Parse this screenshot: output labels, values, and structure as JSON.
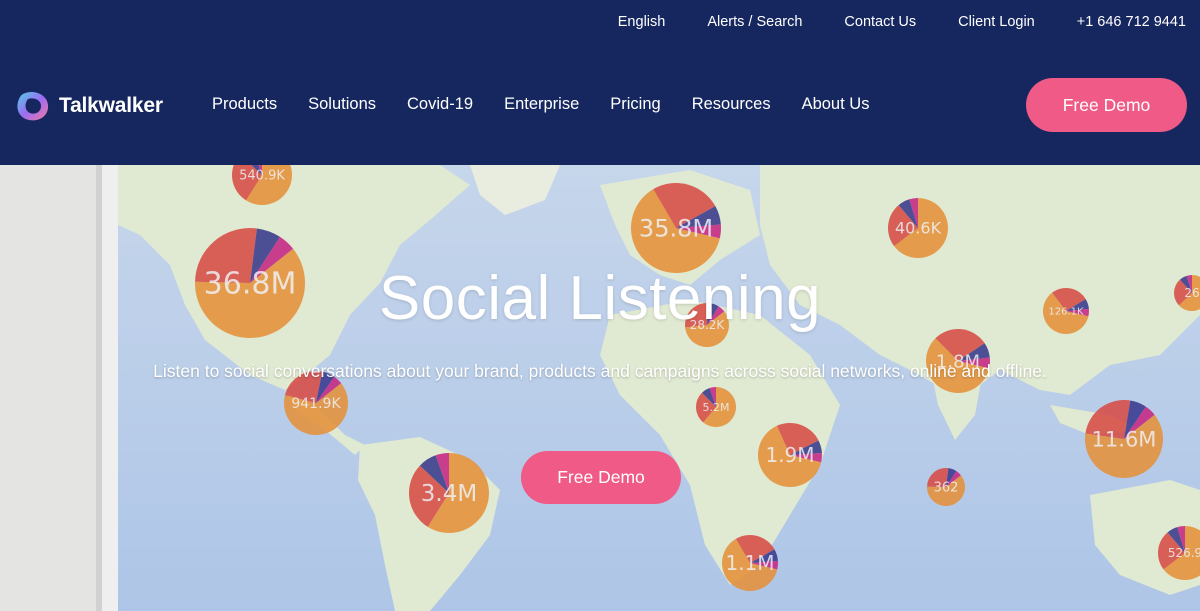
{
  "topbar": {
    "language": "English",
    "alerts_search": "Alerts / Search",
    "contact": "Contact Us",
    "client_login": "Client Login",
    "phone": "+1 646 712 9441"
  },
  "brand": {
    "name": "Talkwalker"
  },
  "nav": {
    "items": [
      "Products",
      "Solutions",
      "Covid-19",
      "Enterprise",
      "Pricing",
      "Resources",
      "About Us"
    ]
  },
  "header_cta": "Free Demo",
  "hero": {
    "title": "Social Listening",
    "subtitle": "Listen to social conversations about your brand, products and campaigns across social networks, online and offline.",
    "cta": "Free Demo"
  },
  "map_bubbles": [
    {
      "label": "540.9K"
    },
    {
      "label": "36.8M"
    },
    {
      "label": "35.8M"
    },
    {
      "label": "40.6K"
    },
    {
      "label": "28.2K"
    },
    {
      "label": "126.1K"
    },
    {
      "label": "26"
    },
    {
      "label": "941.9K"
    },
    {
      "label": "1.8M"
    },
    {
      "label": "5.2M"
    },
    {
      "label": "11.6M"
    },
    {
      "label": "1.9M"
    },
    {
      "label": "3.4M"
    },
    {
      "label": "362"
    },
    {
      "label": "1.1M"
    },
    {
      "label": "526.9"
    }
  ],
  "colors": {
    "header_bg": "#15275e",
    "cta_pink": "#ef5a86",
    "map_sea": "#b9cde8",
    "map_land": "#dfe8cf",
    "pie_orange": "#e48a2d",
    "pie_red": "#d5403a",
    "pie_navy": "#2c2c86",
    "pie_magenta": "#c2187b"
  }
}
